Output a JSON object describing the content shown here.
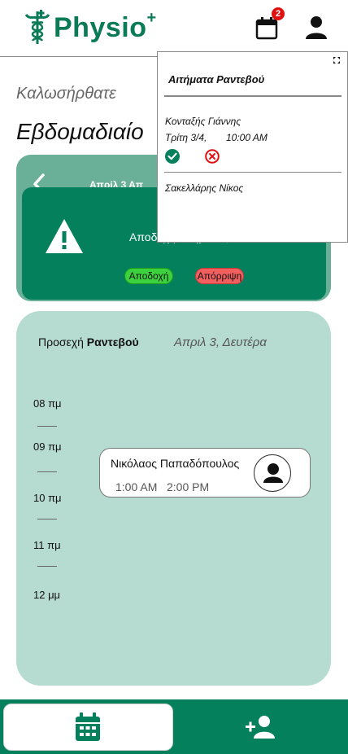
{
  "header": {
    "logo_text": "Physio",
    "logo_plus": "+",
    "notification_count": "2",
    "calendar_icon": "calendar-icon",
    "profile_icon": "user-icon"
  },
  "main": {
    "welcome": "Καλωσήρθατε",
    "weekly_title": "Εβδομαδιαίο",
    "week_date": "Απρίλ 3 Απ"
  },
  "requests": {
    "title": "Αιτήματα Ραντεβού",
    "items": [
      {
        "name": "Κονταξής Γιάννης",
        "date": "Τρίτη 3/4,",
        "time": "10:00 AM"
      },
      {
        "name": "Σακελλάρης Νίκος"
      }
    ]
  },
  "modal": {
    "question": "Αποδοχή αιτήματος ;",
    "accept_label": "Αποδοχή",
    "reject_label": "Απόρριψη"
  },
  "upcoming": {
    "label_prefix": "Προσεχή",
    "label_bold": "Ραντεβού",
    "date": "Απριλ 3, Δευτέρα",
    "hours": [
      "08 πμ",
      "09 πμ",
      "10 πμ",
      "11 πμ",
      "12 μμ"
    ],
    "appointment": {
      "name": "Νικόλαος Παπαδόπουλος",
      "start": "1:00 AM",
      "end": "2:00 PM"
    }
  },
  "colors": {
    "brand_green": "#04805d",
    "card_light": "#b6dbd0",
    "accept": "#3bd23d",
    "reject": "#f25f5f",
    "badge": "#e01010"
  }
}
